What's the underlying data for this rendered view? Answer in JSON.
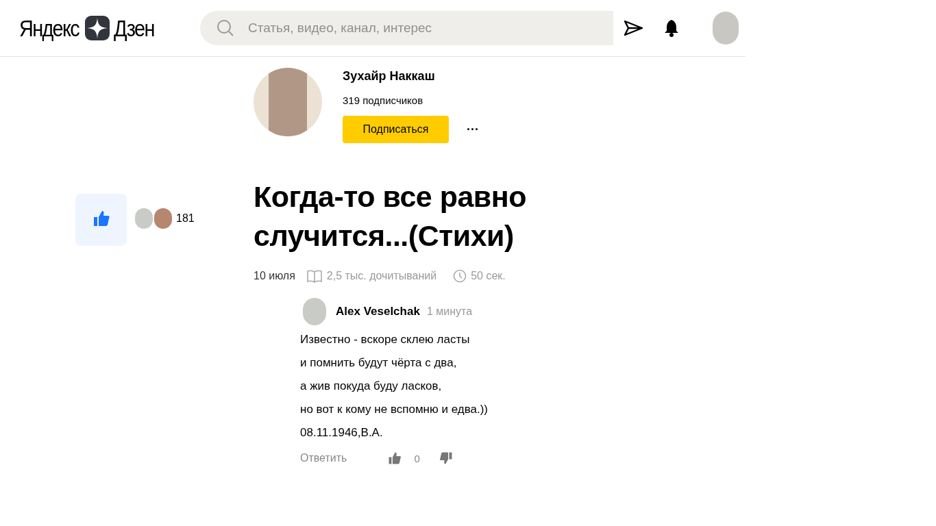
{
  "header": {
    "logo_left": "Яндекс",
    "logo_right": "Дзен",
    "search": {
      "placeholder": "Статья, видео, канал, интерес"
    }
  },
  "channel": {
    "name": "Зухайр Наккаш",
    "subscribers": "319 подписчиков",
    "subscribe_button": "Подписаться",
    "more": "···"
  },
  "likes": {
    "liked": true,
    "count": "181"
  },
  "article": {
    "title": "Когда-то все равно случится...(Стихи)",
    "date": "10 июля",
    "reads": "2,5 тыс. дочитываний",
    "read_time": "50 сек."
  },
  "comment": {
    "author": "Alex Veselchak",
    "time": "1 минута",
    "lines": [
      "Известно - вскоре склею ласты",
      "и помнить будут чёрта с два,",
      "а жив покуда буду ласков,",
      "но вот к кому не вспомню и едва.))",
      "08.11.1946,В.А."
    ],
    "reply": "Ответить",
    "likes": "0"
  }
}
